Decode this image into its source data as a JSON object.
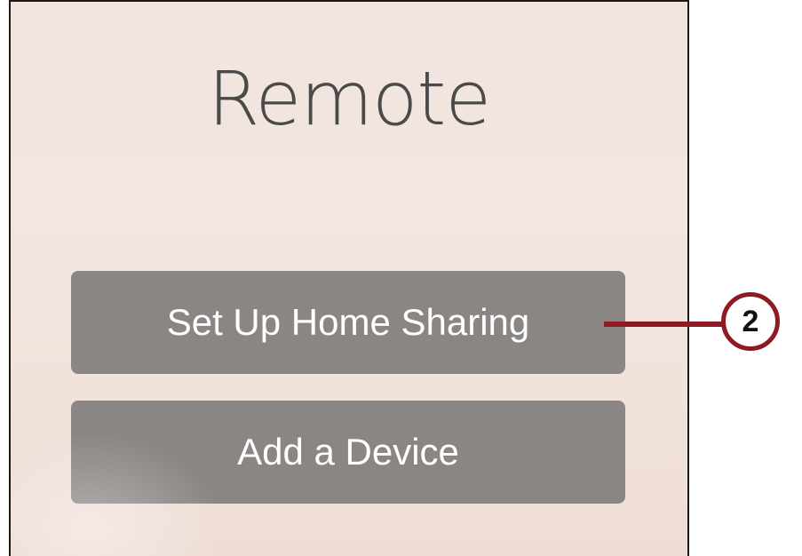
{
  "app": {
    "title": "Remote"
  },
  "buttons": {
    "setup_home_sharing": "Set Up Home Sharing",
    "add_device": "Add a Device"
  },
  "callout": {
    "number": "2",
    "color": "#8e1b24"
  },
  "colors": {
    "background": "#f2e4de",
    "button": "#8a8684",
    "button_text": "#ffffff",
    "title_text": "#4a4a4a"
  }
}
